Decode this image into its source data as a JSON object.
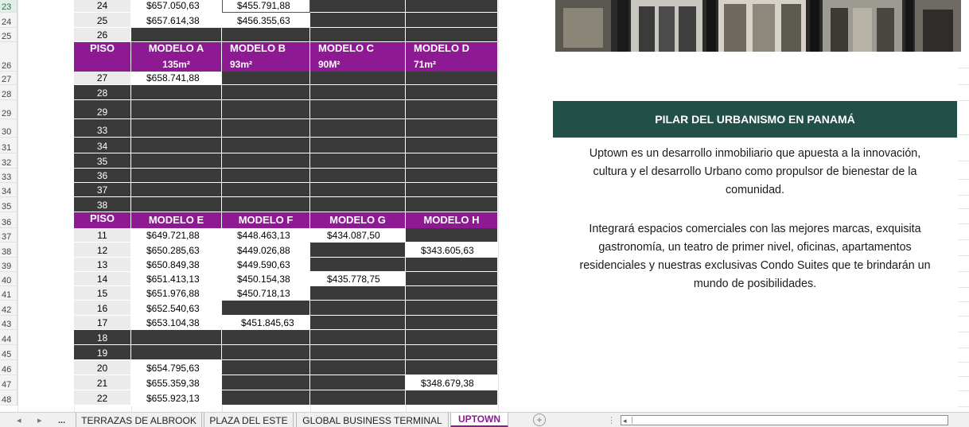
{
  "top_table": {
    "rows": [
      {
        "row": "23",
        "piso": "24",
        "a": "$657.050,63",
        "b": "$455.791,88"
      },
      {
        "row": "24",
        "piso": "25",
        "a": "$657.614,38",
        "b": "$456.355,63"
      },
      {
        "row": "25",
        "piso": "26",
        "a": "",
        "b": ""
      }
    ]
  },
  "header_1": {
    "row": "26",
    "piso": "PISO",
    "models": [
      {
        "name": "MODELO A",
        "area": "135m²"
      },
      {
        "name": "MODELO B",
        "area": "93m²"
      },
      {
        "name": "MODELO C",
        "area": "90M²"
      },
      {
        "name": "MODELO D",
        "area": "71m²"
      }
    ]
  },
  "mid_table": {
    "rows": [
      {
        "row": "27",
        "piso": "27",
        "a": "$658.741,88"
      },
      {
        "row": "28",
        "piso": "28"
      },
      {
        "row": "29",
        "piso": "29"
      },
      {
        "row": "30",
        "piso": "33"
      },
      {
        "row": "31",
        "piso": "34"
      },
      {
        "row": "32",
        "piso": "35"
      },
      {
        "row": "33",
        "piso": "36"
      },
      {
        "row": "34",
        "piso": "37"
      },
      {
        "row": "35",
        "piso": "38"
      }
    ]
  },
  "header_2": {
    "row": "36",
    "piso": "PISO",
    "models": [
      "MODELO E",
      "MODELO F",
      "MODELO G",
      "MODELO H"
    ]
  },
  "bottom_table": {
    "rows": [
      {
        "row": "37",
        "piso": "11",
        "e": "$649.721,88",
        "f": "$448.463,13",
        "g": "$434.087,50",
        "h": ""
      },
      {
        "row": "38",
        "piso": "12",
        "e": "$650.285,63",
        "f": "$449.026,88",
        "g": "",
        "h": "$343.605,63"
      },
      {
        "row": "39",
        "piso": "13",
        "e": "$650.849,38",
        "f": "$449.590,63",
        "g": "",
        "h": ""
      },
      {
        "row": "40",
        "piso": "14",
        "e": "$651.413,13",
        "f": "$450.154,38",
        "g": "$435.778,75",
        "h": ""
      },
      {
        "row": "41",
        "piso": "15",
        "e": "$651.976,88",
        "f": "$450.718,13",
        "g": "",
        "h": ""
      },
      {
        "row": "42",
        "piso": "16",
        "e": "$652.540,63",
        "f": "",
        "g": "",
        "h": ""
      },
      {
        "row": "43",
        "piso": "17",
        "e": "$653.104,38",
        "f": "$451.845,63",
        "g": "",
        "h": ""
      },
      {
        "row": "44",
        "piso": "18",
        "e": "",
        "f": "",
        "g": "",
        "h": ""
      },
      {
        "row": "45",
        "piso": "19",
        "e": "",
        "f": "",
        "g": "",
        "h": ""
      },
      {
        "row": "46",
        "piso": "20",
        "e": "$654.795,63",
        "f": "",
        "g": "",
        "h": ""
      },
      {
        "row": "47",
        "piso": "21",
        "e": "$655.359,38",
        "f": "",
        "g": "",
        "h": "$348.679,38"
      },
      {
        "row": "48",
        "piso": "22",
        "e": "$655.923,13",
        "f": "",
        "g": "",
        "h": ""
      }
    ]
  },
  "info": {
    "banner": "PILAR DEL URBANISMO EN PANAMÁ",
    "para1": [
      "Uptown es un desarrollo inmobiliario que apuesta a la innovación,",
      "cultura y el desarrollo Urbano como propulsor de bienestar de la",
      "comunidad."
    ],
    "para2": [
      "Integrará espacios comerciales con las mejores marcas, exquisita",
      "gastronomía, un teatro de primer nivel, oficinas, apartamentos",
      "residenciales y nuestras exclusivas Condo Suites que te brindarán un",
      "mundo de posibilidades."
    ]
  },
  "sheet_tabs": {
    "nav_prev": "◂",
    "nav_next": "▸",
    "more": "...",
    "tabs": [
      "TERRAZAS DE ALBROOK",
      "PLAZA DEL ESTE",
      "GLOBAL BUSINESS TERMINAL",
      "UPTOWN"
    ],
    "active": "UPTOWN",
    "add": "+"
  },
  "colors": {
    "header_purple": "#8e1a93",
    "banner_green": "#225049",
    "dark_cell": "#3a3a3a"
  }
}
